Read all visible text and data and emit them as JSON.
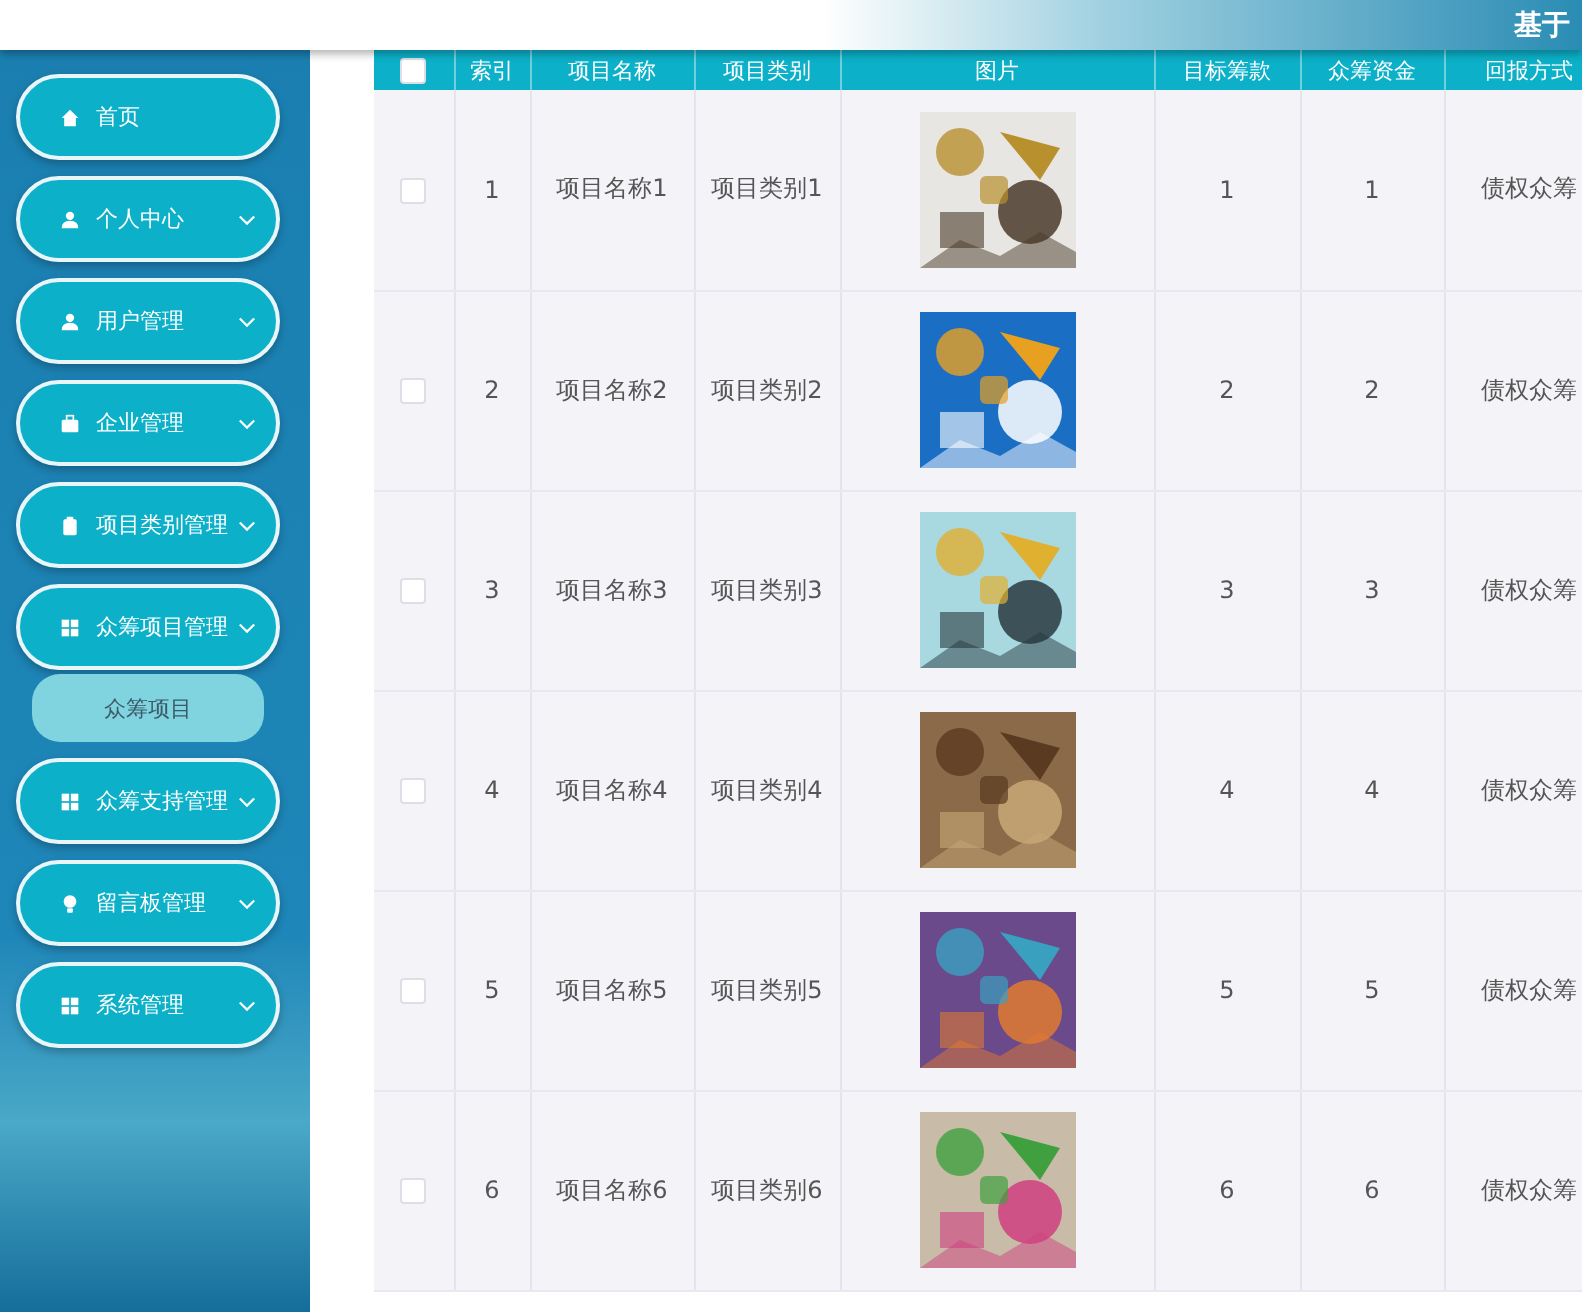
{
  "header": {
    "title": "基于"
  },
  "sidebar": {
    "items": [
      {
        "label": "首页",
        "has_submenu": false,
        "expanded": false
      },
      {
        "label": "个人中心",
        "has_submenu": true,
        "expanded": false
      },
      {
        "label": "用户管理",
        "has_submenu": true,
        "expanded": false
      },
      {
        "label": "企业管理",
        "has_submenu": true,
        "expanded": false
      },
      {
        "label": "项目类别管理",
        "has_submenu": true,
        "expanded": false
      },
      {
        "label": "众筹项目管理",
        "has_submenu": true,
        "expanded": true,
        "children": [
          {
            "label": "众筹项目"
          }
        ]
      },
      {
        "label": "众筹支持管理",
        "has_submenu": true,
        "expanded": false
      },
      {
        "label": "留言板管理",
        "has_submenu": true,
        "expanded": false
      },
      {
        "label": "系统管理",
        "has_submenu": true,
        "expanded": false
      }
    ]
  },
  "table": {
    "select_all": {
      "checked": false
    },
    "columns": [
      "索引",
      "项目名称",
      "项目类别",
      "图片",
      "目标筹款",
      "众筹资金",
      "回报方式"
    ],
    "rows": [
      {
        "checked": false,
        "cells": [
          "1",
          "项目名称1",
          "项目类别1",
          {
            "kind": "picture"
          },
          "1",
          "1",
          "债权众筹"
        ]
      },
      {
        "checked": false,
        "cells": [
          "2",
          "项目名称2",
          "项目类别2",
          {
            "kind": "picture"
          },
          "2",
          "2",
          "债权众筹"
        ]
      },
      {
        "checked": false,
        "cells": [
          "3",
          "项目名称3",
          "项目类别3",
          {
            "kind": "picture"
          },
          "3",
          "3",
          "债权众筹"
        ]
      },
      {
        "checked": false,
        "cells": [
          "4",
          "项目名称4",
          "项目类别4",
          {
            "kind": "picture"
          },
          "4",
          "4",
          "债权众筹"
        ]
      },
      {
        "checked": false,
        "cells": [
          "5",
          "项目名称5",
          "项目类别5",
          {
            "kind": "picture"
          },
          "5",
          "5",
          "债权众筹"
        ]
      },
      {
        "checked": false,
        "cells": [
          "6",
          "项目名称6",
          "项目类别6",
          {
            "kind": "picture"
          },
          "6",
          "6",
          "债权众筹"
        ]
      }
    ]
  }
}
